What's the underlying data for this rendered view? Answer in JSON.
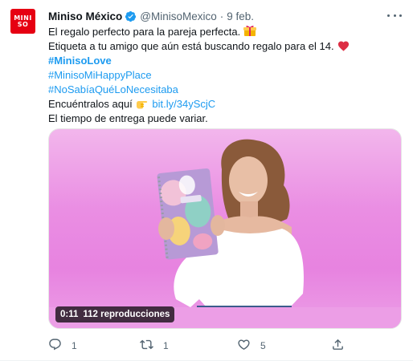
{
  "avatar": {
    "line1": "MINI",
    "line2": "SO"
  },
  "author": {
    "name": "Miniso México",
    "handle": "@MinisoMexico",
    "separator": "·",
    "date": "9 feb."
  },
  "tweet": {
    "line1": "El regalo perfecto para la pareja perfecta.",
    "line2": "Etiqueta a tu amigo que aún está buscando regalo para el 14.",
    "hashtag1": "#MinisoLove",
    "hashtag2": "#MinisoMiHappyPlace",
    "hashtag3": "#NoSabíaQuéLoNecesitaba",
    "line6_text": "Encuéntralos aquí",
    "link": "bit.ly/34yScjC",
    "line7": "El tiempo de entrega puede variar."
  },
  "video": {
    "duration": "0:11",
    "views": "112 reproducciones"
  },
  "actions": {
    "reply_count": "1",
    "retweet_count": "1",
    "like_count": "5"
  },
  "colors": {
    "brand_red": "#e60012",
    "link_blue": "#1d9bf0",
    "muted": "#536471",
    "heart_red": "#dd2e44"
  },
  "icons": [
    "verified-badge-icon",
    "more-icon",
    "gift-icon",
    "heart-emoji-icon",
    "pointing-hand-icon",
    "reply-icon",
    "retweet-icon",
    "like-icon",
    "share-icon"
  ]
}
